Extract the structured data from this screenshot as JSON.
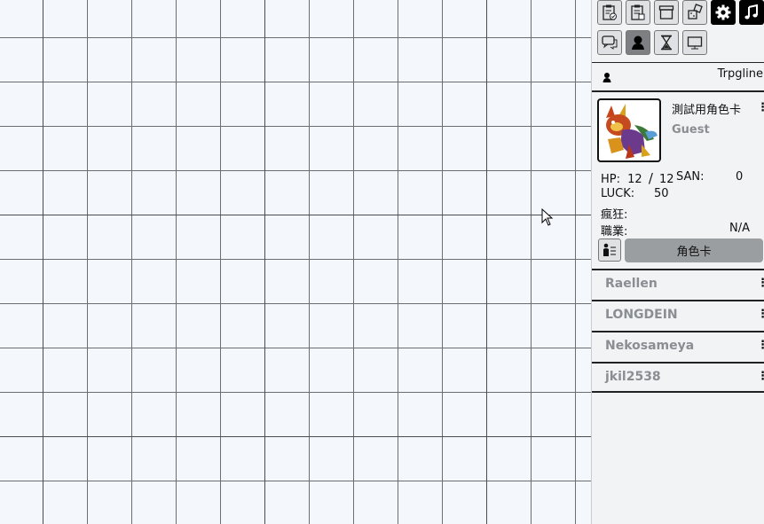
{
  "toolbar": {
    "row1": [
      {
        "icon": "clipboard-check-icon"
      },
      {
        "icon": "clipboard-list-icon"
      },
      {
        "icon": "archive-box-icon"
      },
      {
        "icon": "dice-icon"
      },
      {
        "icon": "gear-icon",
        "dark": true
      },
      {
        "icon": "music-note-icon",
        "dark": true
      }
    ],
    "row2": [
      {
        "icon": "chat-bubbles-icon"
      },
      {
        "icon": "user-silhouette-icon",
        "active": true
      },
      {
        "icon": "hourglass-icon"
      },
      {
        "icon": "monitor-icon"
      }
    ]
  },
  "section": {
    "title": "Trpgline",
    "icon": "user-icon"
  },
  "character": {
    "name": "測試用角色卡",
    "user": "Guest",
    "hp_label": "HP:",
    "hp_current": "12",
    "hp_sep": "/",
    "hp_max": "12",
    "san_label": "SAN:",
    "san_value": "0",
    "luck_label": "LUCK:",
    "luck_value": "50",
    "madness_label": "瘋狂:",
    "job_label": "職業:",
    "job_value": "N/A",
    "sheet_button": "角色卡",
    "kebab": "⋮"
  },
  "users": [
    {
      "name": "Raellen"
    },
    {
      "name": "LONGDEIN"
    },
    {
      "name": "Nekosameya"
    },
    {
      "name": "jkil2538"
    }
  ],
  "kebab": "⋮"
}
